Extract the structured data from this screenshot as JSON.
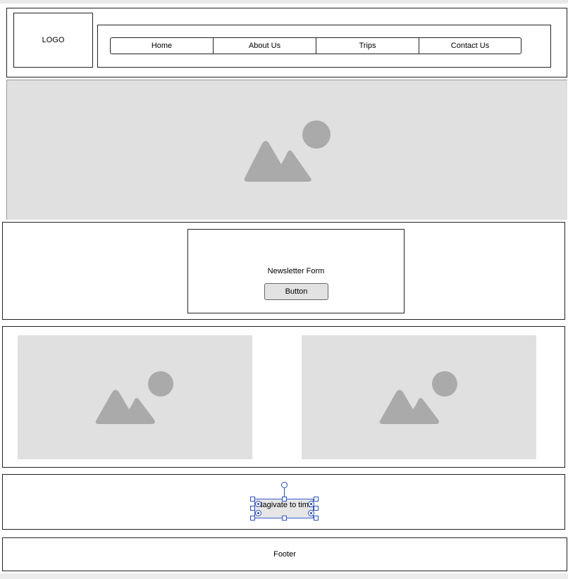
{
  "header": {
    "logo_label": "LOGO",
    "nav": [
      {
        "label": "Home"
      },
      {
        "label": "About Us"
      },
      {
        "label": "Trips"
      },
      {
        "label": "Contact Us"
      }
    ]
  },
  "hero": {
    "image_icon": "image-placeholder-icon"
  },
  "newsletter": {
    "title": "Newsletter Form",
    "button_label": "Button"
  },
  "gallery": {
    "images": [
      {
        "icon": "image-placeholder-icon"
      },
      {
        "icon": "image-placeholder-icon"
      }
    ]
  },
  "navigate": {
    "button_label": "Nagivate to tims"
  },
  "footer": {
    "label": "Footer"
  },
  "colors": {
    "placeholder_bg": "#e0e0e0",
    "placeholder_icon": "#aaaaaa",
    "selection": "#2b4fbf"
  }
}
